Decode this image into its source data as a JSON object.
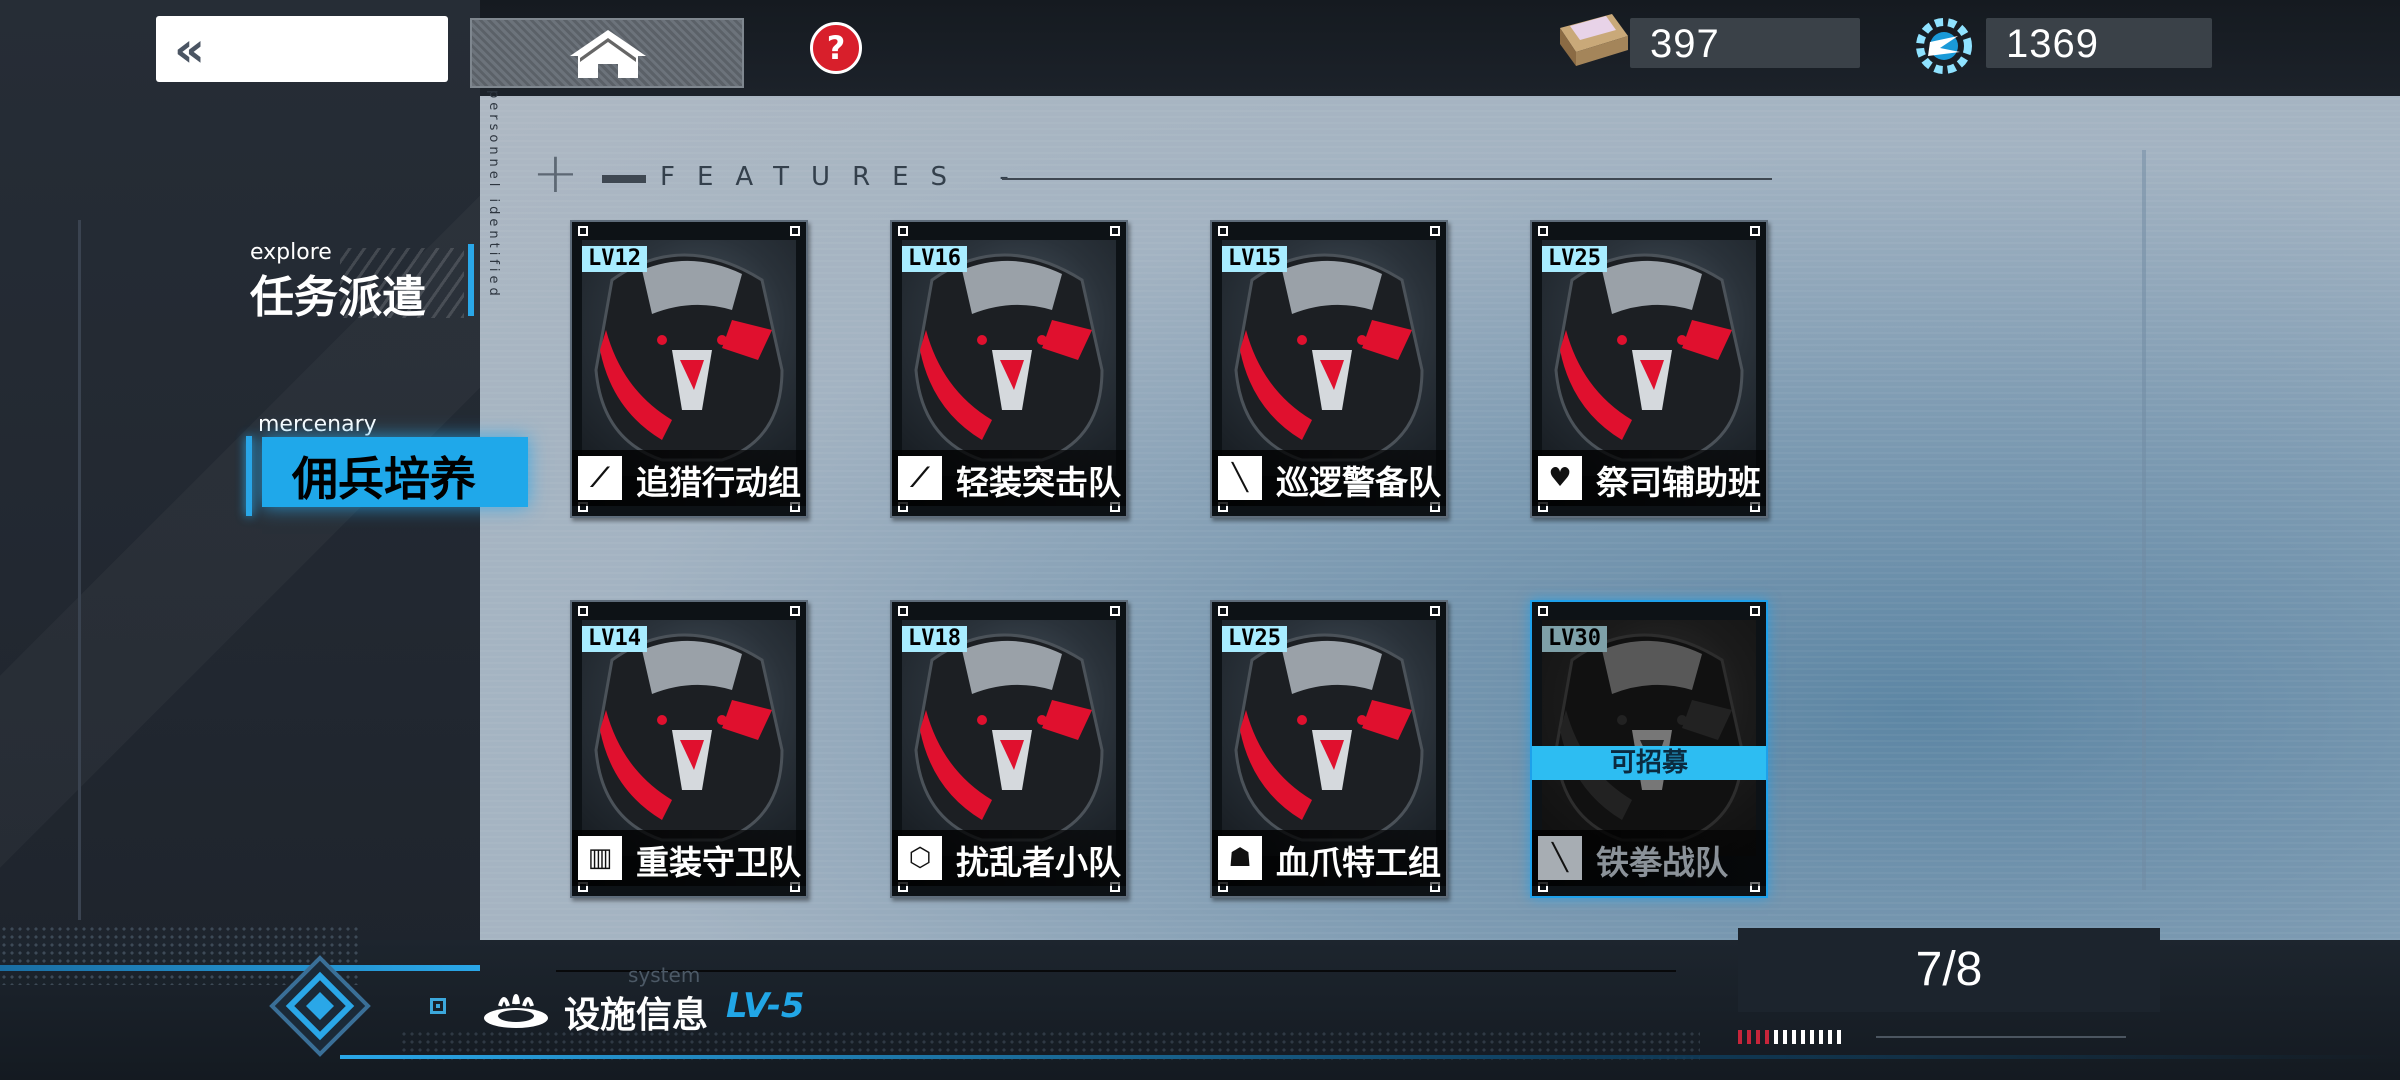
{
  "top_bar": {
    "back_label": "«",
    "help_label": "?",
    "chest_count": "397",
    "energy_count": "1369"
  },
  "side_menu": {
    "explore": {
      "en": "explore",
      "zh": "任务派遣"
    },
    "mercenary": {
      "en": "mercenary",
      "zh": "佣兵培养"
    },
    "vertical_text": "personnel identified"
  },
  "features_title": "FEATURES -",
  "cards": [
    {
      "level": "LV12",
      "name": "追猎行动组",
      "icon": "claw-icon"
    },
    {
      "level": "LV16",
      "name": "轻装突击队",
      "icon": "claw-icon"
    },
    {
      "level": "LV15",
      "name": "巡逻警备队",
      "icon": "slash-icon"
    },
    {
      "level": "LV25",
      "name": "祭司辅助班",
      "icon": "heart-icon"
    },
    {
      "level": "LV14",
      "name": "重装守卫队",
      "icon": "armor-icon"
    },
    {
      "level": "LV18",
      "name": "扰乱者小队",
      "icon": "hex-icon"
    },
    {
      "level": "LV25",
      "name": "血爪特工组",
      "icon": "mask-icon"
    },
    {
      "level": "LV30",
      "name": "铁拳战队",
      "icon": "slash-icon",
      "status": "可招募"
    }
  ],
  "bottom": {
    "system_label": "system",
    "facility_label": "设施信息",
    "facility_level": "LV-5",
    "count": "7/8"
  },
  "colors": {
    "accent": "#2aa7e8",
    "level_tag": "#a8ecff",
    "help_red": "#d81f2b",
    "mech_red": "#e0102e"
  }
}
